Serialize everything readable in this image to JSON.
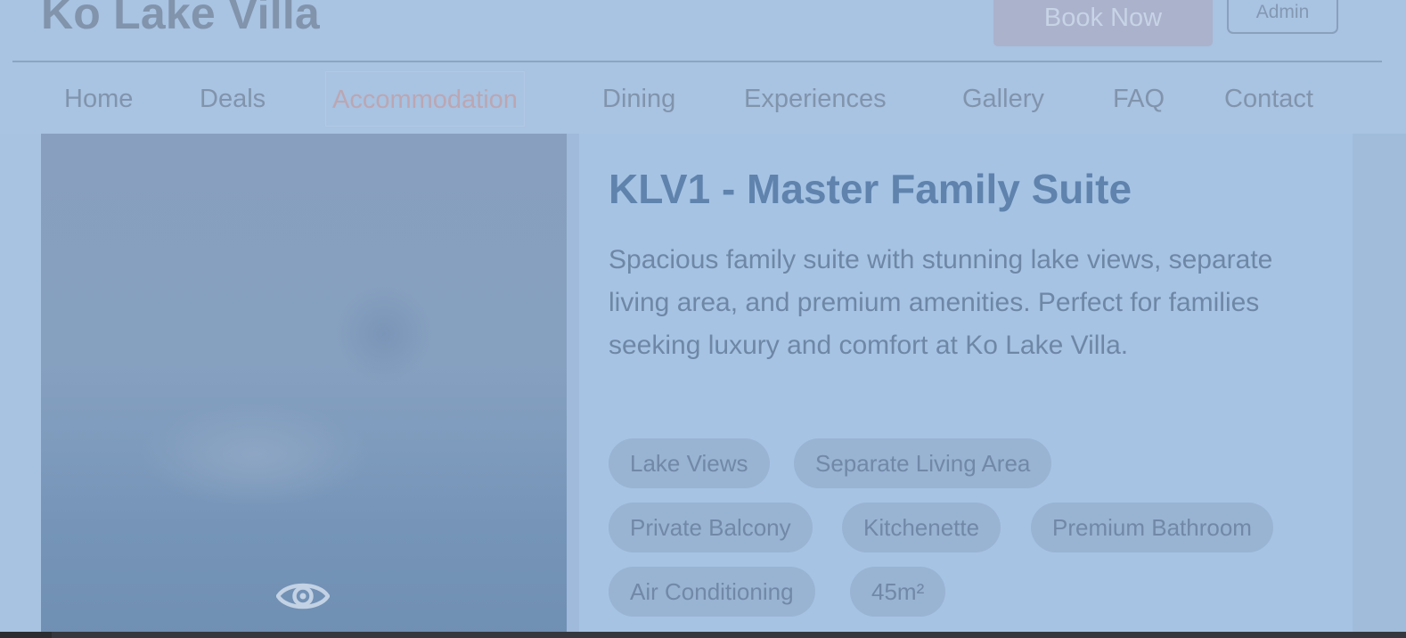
{
  "header": {
    "logo": "Ko Lake Villa",
    "book_button": "Book Now",
    "admin_button": "Admin"
  },
  "nav": {
    "items": [
      {
        "label": "Home"
      },
      {
        "label": "Deals"
      },
      {
        "label": "Accommodation",
        "active": true
      },
      {
        "label": "Dining"
      },
      {
        "label": "Experiences"
      },
      {
        "label": "Gallery"
      },
      {
        "label": "FAQ"
      },
      {
        "label": "Contact"
      }
    ]
  },
  "room": {
    "title": "KLV1 - Master Family Suite",
    "description": "Spacious family suite with stunning lake views, separate living area, and premium amenities. Perfect for families seeking luxury and comfort at Ko Lake Villa.",
    "image_icon": "eye-icon",
    "tags": [
      "Lake Views",
      "Separate Living Area",
      "Private Balcony",
      "Kitchenette",
      "Premium Bathroom",
      "Air Conditioning",
      "45m²"
    ]
  },
  "colors": {
    "background": "#a8c3e2",
    "title": "#5f83ad",
    "active_nav": "#bba7b3",
    "tag_bg": "#99b3d3"
  }
}
